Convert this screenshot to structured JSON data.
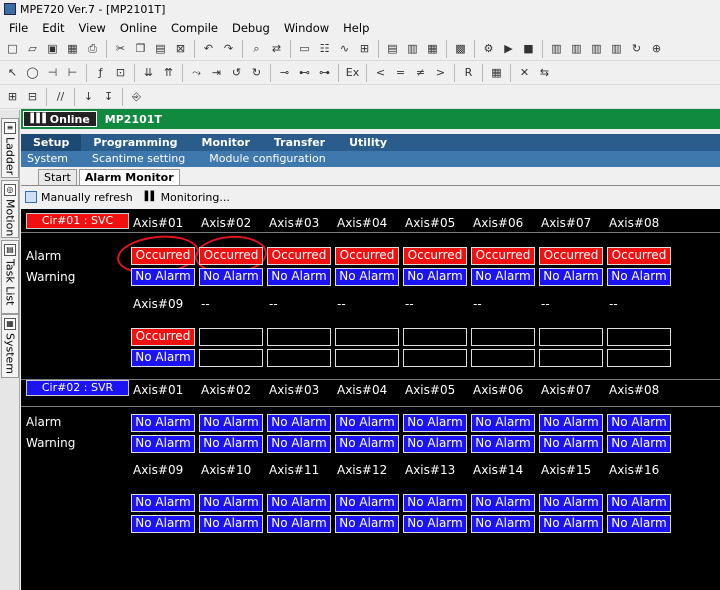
{
  "window": {
    "title": "MPE720 Ver.7 - [MP2101T]"
  },
  "menubar": [
    "File",
    "Edit",
    "View",
    "Online",
    "Compile",
    "Debug",
    "Window",
    "Help"
  ],
  "toolbar_rows": [
    [
      "new-file-icon",
      "open-folder-icon",
      "save-icon",
      "save-all-icon",
      "print-icon",
      "sep",
      "cut-icon",
      "copy-icon",
      "paste-icon",
      "online-edit-icon",
      "sep",
      "undo-icon",
      "redo-icon",
      "sep",
      "find-icon",
      "replace-icon",
      "sep",
      "monitor-icon",
      "ladder-icon",
      "trace-icon",
      "tuning-icon",
      "sep",
      "window-h-icon",
      "window-v-icon",
      "grid-icon",
      "sep",
      "layout-icon",
      "sep",
      "compile-icon",
      "run-icon",
      "stop-icon",
      "sep",
      "module-icon",
      "module2-icon",
      "module3-icon",
      "module4-icon",
      "refresh-icon",
      "zoom-icon"
    ],
    [
      "cursor-icon",
      "coil-icon",
      "contact-icon",
      "branch-icon",
      "sep",
      "function-icon",
      "compare-icon",
      "sep",
      "down-arrows-icon",
      "up-arrows-icon",
      "sep",
      "jump-icon",
      "call-icon",
      "loop-icon",
      "loop2-icon",
      "sep",
      "edge-icon",
      "edge2-icon",
      "edge3-icon",
      "sep",
      "expression-icon",
      "sep",
      "lt-icon",
      "eq-icon",
      "ne-icon",
      "gt-icon",
      "sep",
      "rchk-icon",
      "sep",
      "table-icon",
      "sep",
      "bit-icon",
      "swap-icon"
    ],
    [
      "row-insert-icon",
      "row-delete-icon",
      "sep",
      "comment-icon",
      "sep",
      "pin-icon",
      "pin2-icon",
      "sep",
      "io-icon"
    ]
  ],
  "side_tabs": [
    {
      "label": "Ladder",
      "icon": "ladder-tab-icon"
    },
    {
      "label": "Motion",
      "icon": "motion-tab-icon"
    },
    {
      "label": "Task List",
      "icon": "tasklist-tab-icon"
    },
    {
      "label": "System",
      "icon": "system-tab-icon"
    }
  ],
  "status": {
    "online_label": "Online",
    "cpu": "MP2101T"
  },
  "module_menu": [
    "Setup",
    "Programming",
    "Monitor",
    "Transfer",
    "Utility"
  ],
  "sub_menu": [
    "System",
    "Scantime setting",
    "Module configuration"
  ],
  "tabs": [
    "Start",
    "Alarm Monitor"
  ],
  "commands": {
    "manual_refresh": "Manually refresh",
    "monitoring": "Monitoring..."
  },
  "colors": {
    "occurred": "#f11010",
    "no_alarm": "#1c13f5",
    "online_bar": "#0f8a3e",
    "panel": "#000000"
  },
  "alarm_monitor": {
    "circuit1": {
      "label": "Cir#01 : SVC",
      "color": "#f11010",
      "axes_row1": [
        "Axis#01",
        "Axis#02",
        "Axis#03",
        "Axis#04",
        "Axis#05",
        "Axis#06",
        "Axis#07",
        "Axis#08"
      ],
      "alarm_row1": [
        "Occurred",
        "Occurred",
        "Occurred",
        "Occurred",
        "Occurred",
        "Occurred",
        "Occurred",
        "Occurred"
      ],
      "warning_row1": [
        "No Alarm",
        "No Alarm",
        "No Alarm",
        "No Alarm",
        "No Alarm",
        "No Alarm",
        "No Alarm",
        "No Alarm"
      ],
      "axes_row2": [
        "Axis#09",
        "--",
        "--",
        "--",
        "--",
        "--",
        "--",
        "--"
      ],
      "alarm_row2": [
        "Occurred",
        "",
        "",
        "",
        "",
        "",
        "",
        ""
      ],
      "warning_row2": [
        "No Alarm",
        "",
        "",
        "",
        "",
        "",
        "",
        ""
      ]
    },
    "circuit2": {
      "label": "Cir#02 : SVR",
      "color": "#1c13f5",
      "axes_row1": [
        "Axis#01",
        "Axis#02",
        "Axis#03",
        "Axis#04",
        "Axis#05",
        "Axis#06",
        "Axis#07",
        "Axis#08"
      ],
      "alarm_row1": [
        "No Alarm",
        "No Alarm",
        "No Alarm",
        "No Alarm",
        "No Alarm",
        "No Alarm",
        "No Alarm",
        "No Alarm"
      ],
      "warning_row1": [
        "No Alarm",
        "No Alarm",
        "No Alarm",
        "No Alarm",
        "No Alarm",
        "No Alarm",
        "No Alarm",
        "No Alarm"
      ],
      "axes_row2": [
        "Axis#09",
        "Axis#10",
        "Axis#11",
        "Axis#12",
        "Axis#13",
        "Axis#14",
        "Axis#15",
        "Axis#16"
      ],
      "alarm_row2": [
        "No Alarm",
        "No Alarm",
        "No Alarm",
        "No Alarm",
        "No Alarm",
        "No Alarm",
        "No Alarm",
        "No Alarm"
      ],
      "warning_row2": [
        "No Alarm",
        "No Alarm",
        "No Alarm",
        "No Alarm",
        "No Alarm",
        "No Alarm",
        "No Alarm",
        "No Alarm"
      ]
    },
    "row_labels": {
      "alarm": "Alarm",
      "warning": "Warning"
    }
  }
}
